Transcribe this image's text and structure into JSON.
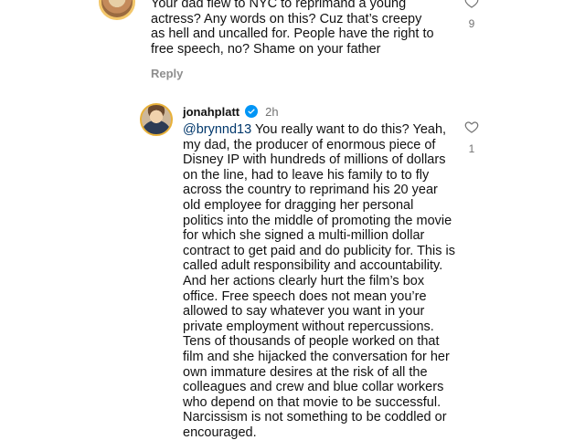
{
  "parent_comment": {
    "text": "Your dad flew to NYC to reprimand a young actress? Any words on this? Cuz that’s creepy as hell and uncalled for. People have the right to free speech, no? Shame on your father",
    "reply_label": "Reply",
    "like_count": "9"
  },
  "reply_comment": {
    "username": "jonahplatt",
    "time": "2h",
    "mention": "@brynnd13",
    "text": "You really want to do this? Yeah, my dad, the producer of enormous piece of Disney IP with hundreds of millions of dollars on the line, had to leave his family to to fly across the country to reprimand his 20 year old employee for dragging her personal politics into the middle of promoting the movie for which she signed a multi-million dollar contract to get paid and do publicity for. This is called adult responsibility and accountability. And her actions clearly hurt the film’s box office. Free speech does not mean you’re allowed to say whatever you want in your private employment without repercussions. Tens of thousands of people worked on that film and she hijacked the conversation for her own immature desires at the risk of all the colleagues and crew and blue collar workers who depend on that movie to be successful. Narcissism is not something to be coddled or encouraged.",
    "like_count": "1"
  },
  "icons": {
    "like": "heart-outline-icon",
    "verified": "verified-badge-icon"
  },
  "colors": {
    "verified_blue": "#0095f6",
    "mention_blue": "#00376b",
    "muted_gray": "#737373",
    "avatar_ring": "#e8b13a"
  }
}
